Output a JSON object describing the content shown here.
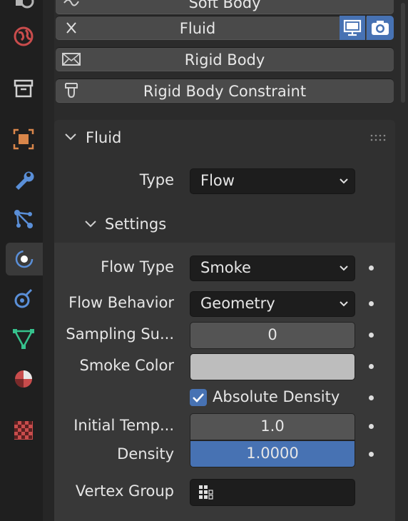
{
  "sidebar": {
    "items": [
      {
        "icon": "scene-icon",
        "color": "#b4b4b4"
      },
      {
        "icon": "world-icon",
        "color": "#c94c4c"
      },
      {
        "icon": "collection-icon",
        "color": "#d0d0d0"
      },
      {
        "icon": "object-icon",
        "color": "#d9864a"
      },
      {
        "icon": "wrench-modifier-icon",
        "color": "#5a8fd8"
      },
      {
        "icon": "particles-icon",
        "color": "#5a8fd8"
      },
      {
        "icon": "physics-icon",
        "color": "#5a8fd8",
        "active": true
      },
      {
        "icon": "constraints-icon",
        "color": "#5a8fd8"
      },
      {
        "icon": "object-data-mesh-icon",
        "color": "#36c28d"
      },
      {
        "icon": "material-icon",
        "color": "#c94c4c"
      },
      {
        "icon": "texture-icon",
        "color": "#c94c4c"
      }
    ]
  },
  "modifiers": {
    "soft_body": "Soft Body",
    "fluid": "Fluid",
    "rigid_body": "Rigid Body",
    "rigid_body_constraint": "Rigid Body Constraint"
  },
  "panel": {
    "title": "Fluid",
    "type_label": "Type",
    "type_value": "Flow",
    "settings_title": "Settings",
    "rows": {
      "flow_type_label": "Flow Type",
      "flow_type_value": "Smoke",
      "flow_behavior_label": "Flow Behavior",
      "flow_behavior_value": "Geometry",
      "sampling_label": "Sampling Su...",
      "sampling_value": "0",
      "smoke_color_label": "Smoke Color",
      "smoke_color_value": "#bdbdbd",
      "absolute_density_label": "Absolute Density",
      "absolute_density_checked": true,
      "initial_temp_label": "Initial Temp...",
      "initial_temp_value": "1.0",
      "density_label": "Density",
      "density_value": "1.0000",
      "vertex_group_label": "Vertex Group",
      "vertex_group_value": ""
    }
  },
  "colors": {
    "accent": "#4772b3",
    "panel_bg": "#303030",
    "subpanel_bg": "#383838",
    "field_bg": "#1d1d1d"
  }
}
